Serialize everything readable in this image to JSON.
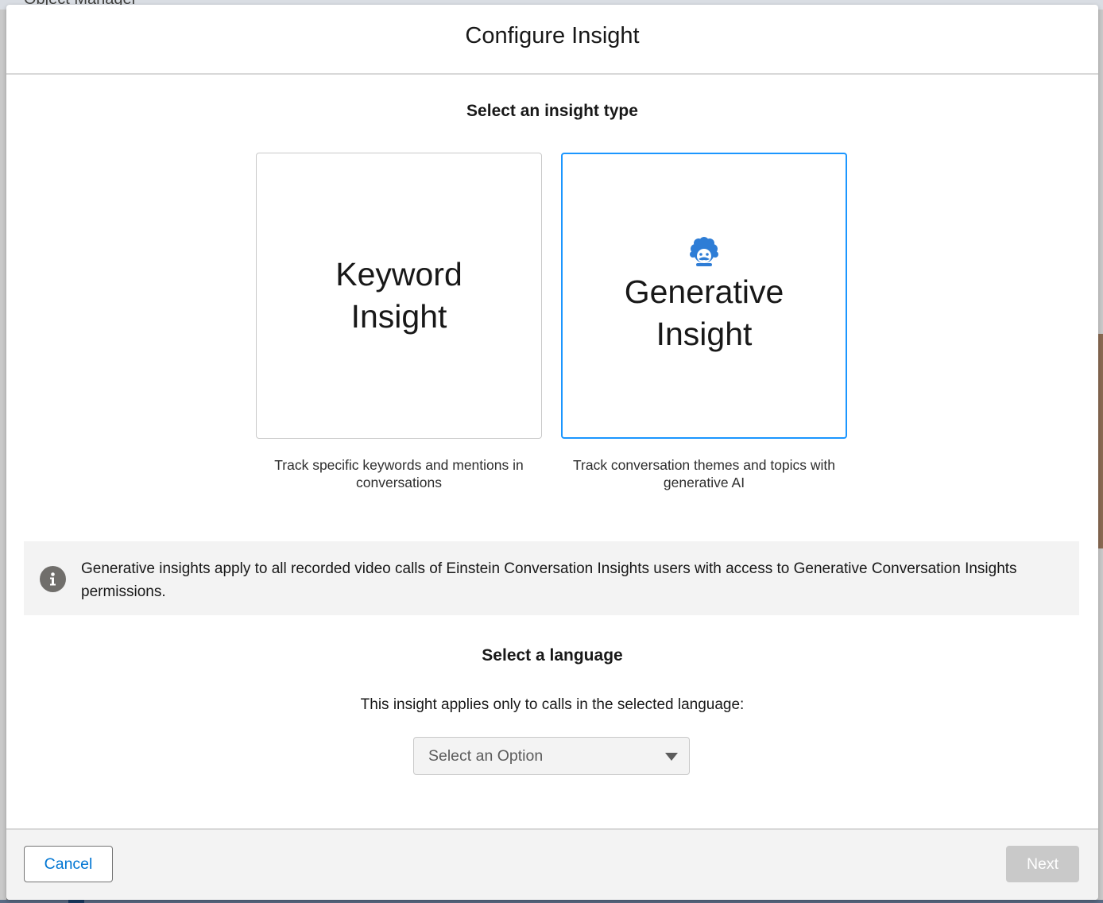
{
  "background": {
    "topbar_text": "Object Manager"
  },
  "modal": {
    "title": "Configure Insight",
    "insight_type": {
      "heading": "Select an insight type",
      "options": [
        {
          "title": "Keyword Insight",
          "description": "Track specific keywords and mentions in conversations",
          "selected": false
        },
        {
          "title": "Generative Insight",
          "description": "Track conversation themes and topics with generative AI",
          "icon": "einstein-icon",
          "selected": true
        }
      ]
    },
    "info": {
      "icon": "info-icon",
      "text": "Generative insights apply to all recorded video calls of Einstein Conversation Insights users with access to Generative Conversation Insights permissions."
    },
    "language": {
      "heading": "Select a language",
      "help_text": "This insight applies only to calls in the selected language:",
      "select_placeholder": "Select an Option"
    },
    "footer": {
      "cancel_label": "Cancel",
      "next_label": "Next"
    }
  },
  "colors": {
    "brand_blue": "#0176d3",
    "selected_border": "#1b96ff",
    "einstein_icon": "#2e7dd6",
    "disabled_button": "#c9c9c9",
    "info_icon": "#706e6b"
  }
}
